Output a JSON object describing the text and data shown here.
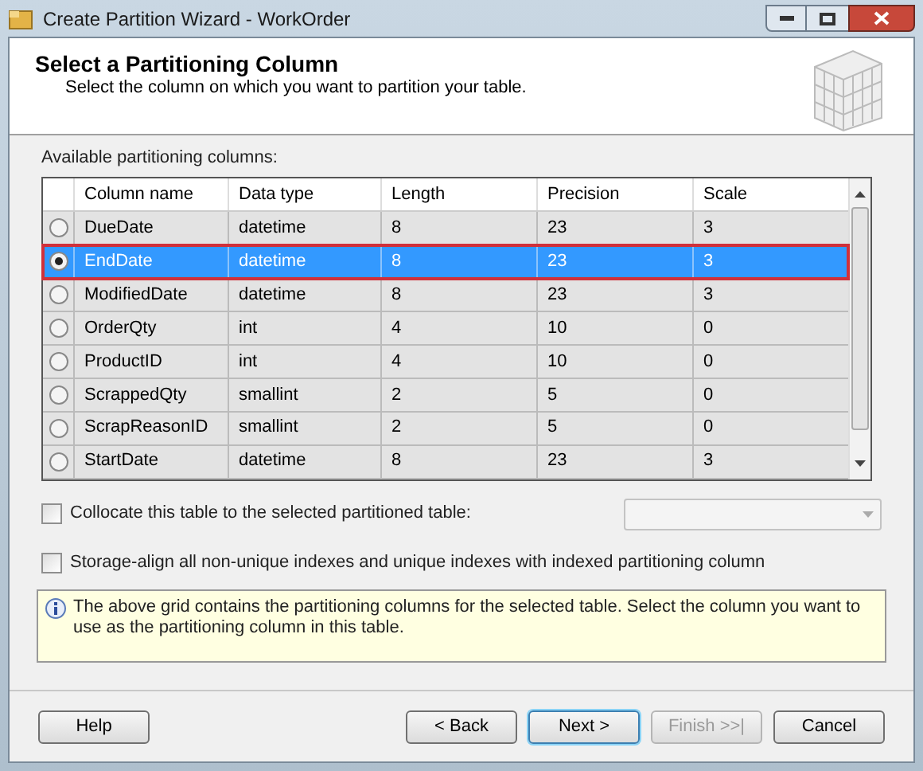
{
  "window": {
    "title": "Create Partition Wizard - WorkOrder"
  },
  "header": {
    "title": "Select a Partitioning Column",
    "subtitle": "Select the column on which you want to partition your table."
  },
  "grid": {
    "label": "Available partitioning columns:",
    "columns": [
      "Column name",
      "Data type",
      "Length",
      "Precision",
      "Scale"
    ],
    "rows": [
      {
        "selected": false,
        "cells": [
          "DueDate",
          "datetime",
          "8",
          "23",
          "3"
        ]
      },
      {
        "selected": true,
        "cells": [
          "EndDate",
          "datetime",
          "8",
          "23",
          "3"
        ]
      },
      {
        "selected": false,
        "cells": [
          "ModifiedDate",
          "datetime",
          "8",
          "23",
          "3"
        ]
      },
      {
        "selected": false,
        "cells": [
          "OrderQty",
          "int",
          "4",
          "10",
          "0"
        ]
      },
      {
        "selected": false,
        "cells": [
          "ProductID",
          "int",
          "4",
          "10",
          "0"
        ]
      },
      {
        "selected": false,
        "cells": [
          "ScrappedQty",
          "smallint",
          "2",
          "5",
          "0"
        ]
      },
      {
        "selected": false,
        "cells": [
          "ScrapReasonID",
          "smallint",
          "2",
          "5",
          "0"
        ]
      },
      {
        "selected": false,
        "cells": [
          "StartDate",
          "datetime",
          "8",
          "23",
          "3"
        ]
      }
    ]
  },
  "options": [
    {
      "label": "Collocate this table to the selected partitioned table:",
      "checked": false,
      "dropdown": true
    },
    {
      "label": "Storage-align all non-unique indexes and unique indexes with indexed partitioning column",
      "checked": false
    }
  ],
  "info": "The above grid contains the partitioning columns for the selected table. Select the column you want to use as the partitioning column in this table.",
  "buttons": [
    {
      "label": "Help",
      "disabled": false,
      "default": false
    },
    {
      "label": "< Back",
      "disabled": false,
      "default": false
    },
    {
      "label": "Next >",
      "disabled": false,
      "default": true
    },
    {
      "label": "Finish >>|",
      "disabled": true,
      "default": false
    },
    {
      "label": "Cancel",
      "disabled": false,
      "default": false
    }
  ]
}
